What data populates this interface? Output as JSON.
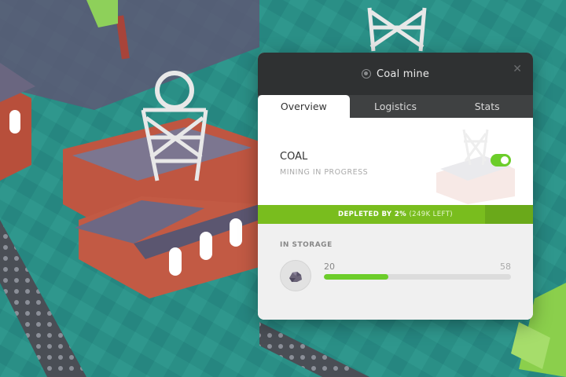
{
  "window": {
    "title": "Coal mine",
    "close_label": "✕"
  },
  "tabs": [
    {
      "label": "Overview",
      "active": true
    },
    {
      "label": "Logistics",
      "active": false
    },
    {
      "label": "Stats",
      "active": false
    }
  ],
  "resource": {
    "name": "COAL",
    "status": "MINING IN PROGRESS",
    "mining_enabled": true
  },
  "depletion": {
    "label": "DEPLETED BY 2%",
    "detail": "(249K LEFT)",
    "percent": 2
  },
  "storage": {
    "label": "IN STORAGE",
    "current": "20",
    "max": "58",
    "fill_fraction": 0.345
  },
  "colors": {
    "accent_green": "#6ccd2a",
    "header_dark": "#2f3132",
    "ground_teal": "#2a8f86",
    "brick_red": "#c0553e"
  }
}
